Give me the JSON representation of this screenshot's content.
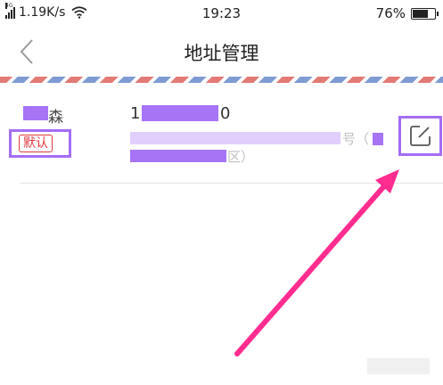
{
  "status_bar": {
    "network_type": "4G",
    "speed": "1.19K/s",
    "time": "19:23",
    "battery": "76%",
    "battery_level": 0.76
  },
  "nav": {
    "back_icon": "chevron-left-icon",
    "title": "地址管理"
  },
  "address": {
    "name_visible": "森",
    "default_badge": "默认",
    "phone_start": "1",
    "phone_end": "0",
    "line1_fragment": "号（",
    "line2_fragment": "区）",
    "edit_icon": "edit-icon"
  },
  "colors": {
    "highlight": "#a46df5",
    "arrow": "#ff2d8f",
    "badge_red": "#e0393e",
    "stripe_red": "#e27a76",
    "stripe_blue": "#7f9bd3"
  }
}
